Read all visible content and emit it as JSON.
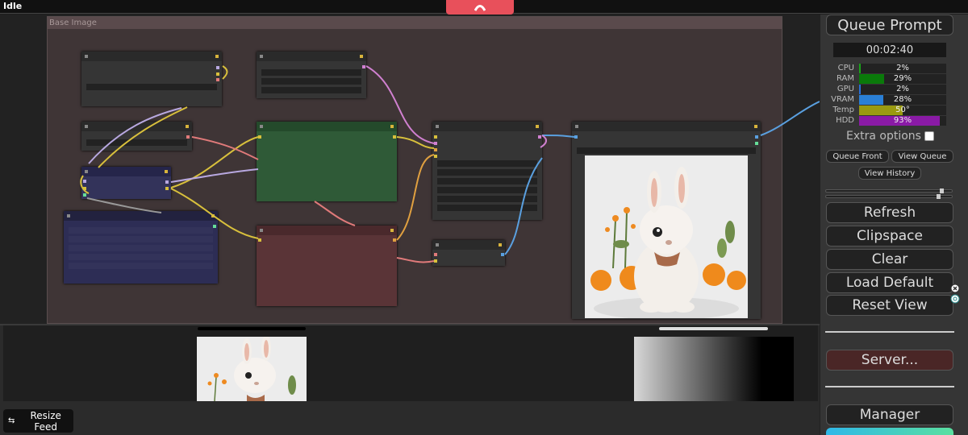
{
  "status": {
    "text": "Idle"
  },
  "canvas": {
    "group_title": "Base Image"
  },
  "feed": {
    "resize_label": "Resize Feed",
    "resize_icon": "resize-arrows-icon"
  },
  "panel": {
    "queue_prompt": "Queue Prompt",
    "timer": "00:02:40",
    "stats": [
      {
        "label": "CPU",
        "value": "2%",
        "fill": 0.02,
        "color": "#1aa31a"
      },
      {
        "label": "RAM",
        "value": "29%",
        "fill": 0.29,
        "color": "#0a7a0a"
      },
      {
        "label": "GPU",
        "value": "2%",
        "fill": 0.02,
        "color": "#2a6fd6"
      },
      {
        "label": "VRAM",
        "value": "28%",
        "fill": 0.28,
        "color": "#2a7fd6"
      },
      {
        "label": "Temp",
        "value": "50°",
        "fill": 0.5,
        "color": "#9a9a10"
      },
      {
        "label": "HDD",
        "value": "93%",
        "fill": 0.93,
        "color": "#8a1aa6"
      }
    ],
    "extra_options": "Extra options",
    "queue_front": "Queue Front",
    "view_queue": "View Queue",
    "view_history": "View History",
    "refresh": "Refresh",
    "clipspace": "Clipspace",
    "clear": "Clear",
    "load_default": "Load Default",
    "reset_view": "Reset View",
    "server": "Server...",
    "manager": "Manager"
  },
  "colors": {
    "accent": "#e8505b",
    "group_bg": "#3f3536",
    "green_node": "#2f5a37",
    "red_node": "#5a3437",
    "purple_node": "#33335a"
  }
}
